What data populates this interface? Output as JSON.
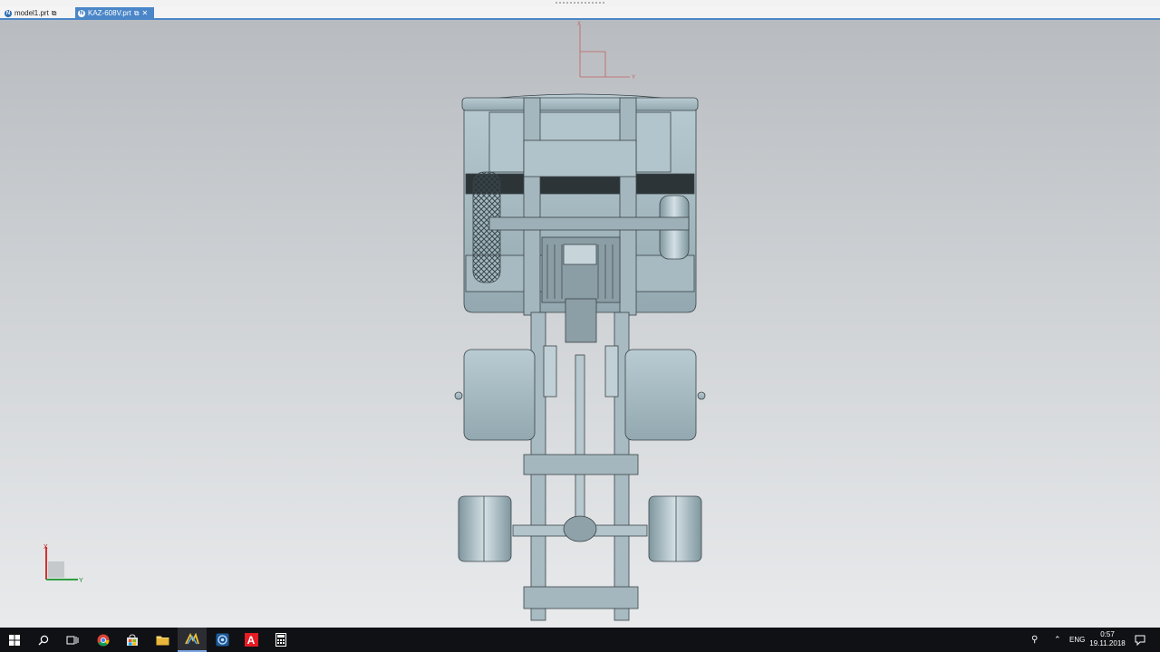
{
  "tabs": [
    {
      "label": "model1.prt",
      "active": false
    },
    {
      "label": "KAZ-608V.prt",
      "active": true
    }
  ],
  "view_triad": {
    "x_label": "X",
    "y_label": "Y"
  },
  "corner_triad": {
    "x_label": "X",
    "y_label": "Y"
  },
  "taskbar": {
    "apps": [
      {
        "name": "start",
        "icon": "windows-icon"
      },
      {
        "name": "search",
        "icon": "search-icon"
      },
      {
        "name": "task-view",
        "icon": "task-view-icon"
      },
      {
        "name": "chrome",
        "icon": "chrome-icon"
      },
      {
        "name": "store",
        "icon": "store-icon"
      },
      {
        "name": "file-explorer",
        "icon": "folder-icon"
      },
      {
        "name": "nx",
        "icon": "nx-icon",
        "active": true
      },
      {
        "name": "app",
        "icon": "gear-app-icon"
      },
      {
        "name": "autocad",
        "icon": "autocad-icon",
        "letter": "A"
      },
      {
        "name": "calculator",
        "icon": "calculator-icon"
      }
    ],
    "language": "ENG",
    "time": "0:57",
    "date": "19.11.2018"
  },
  "colors": {
    "accent": "#4a86c8",
    "model_fill": "#a9bcc3",
    "model_stroke": "#3a4448",
    "taskbar": "#101114"
  }
}
